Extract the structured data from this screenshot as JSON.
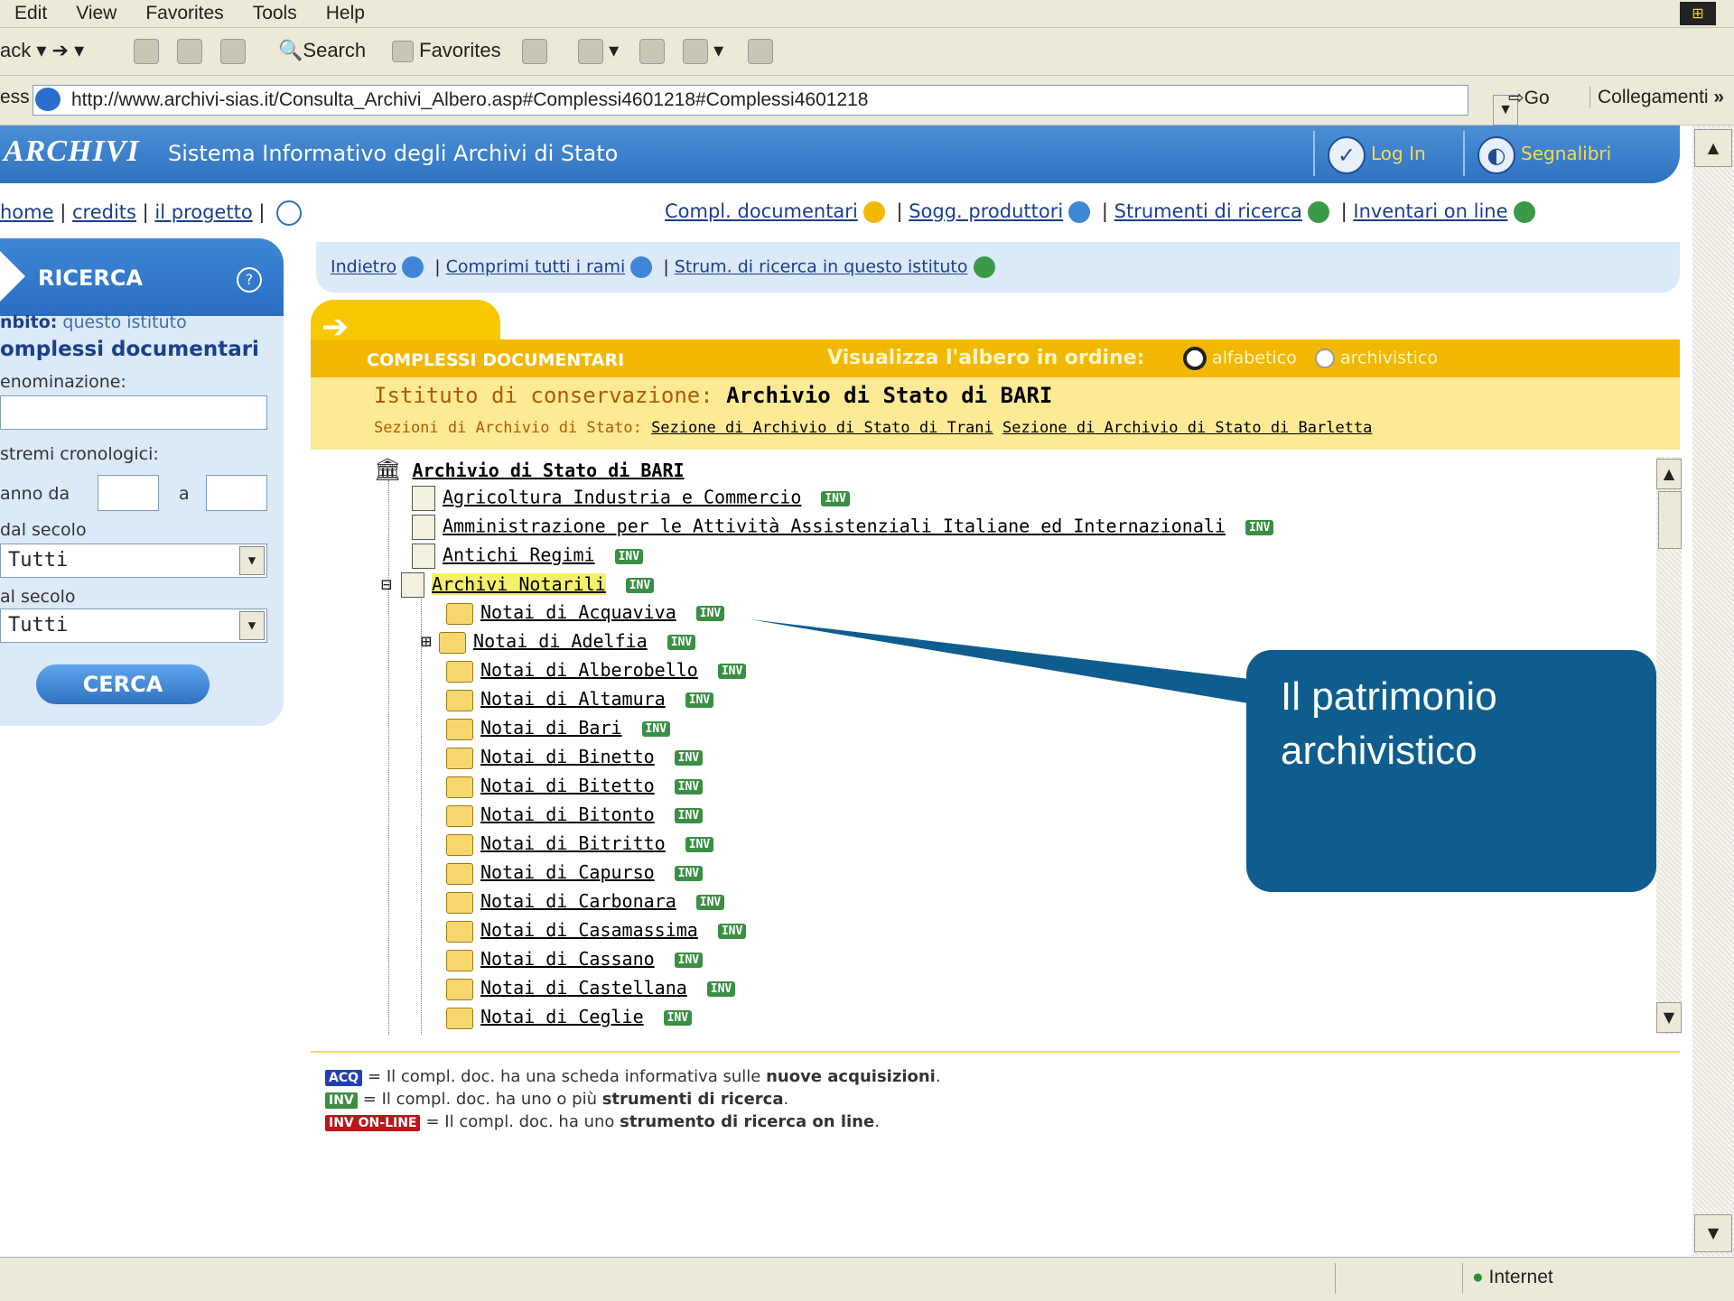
{
  "menu": [
    "Edit",
    "View",
    "Favorites",
    "Tools",
    "Help"
  ],
  "toolbar": {
    "back": "ack",
    "search": "Search",
    "favorites": "Favorites"
  },
  "address": {
    "label": "ess",
    "url": "http://www.archivi-sias.it/Consulta_Archivi_Albero.asp#Complessi4601218#Complessi4601218",
    "go": "Go",
    "links": "Collegamenti",
    "chevrons": "»"
  },
  "header": {
    "logo": "ARCHIVI",
    "subtitle": "Sistema Informativo degli Archivi di Stato",
    "login": "Log In",
    "bookmarks": "Segnalibri"
  },
  "topnav": {
    "home": "home",
    "credits": "credits",
    "progetto": "il progetto",
    "compl": "Compl. documentari",
    "sogg": "Sogg. produttori",
    "strumenti": "Strumenti di ricerca",
    "inventari": "Inventari on line"
  },
  "search": {
    "title": "RICERCA",
    "ambito_label": "nbito:",
    "ambito_value": "questo istituto",
    "section": "omplessi documentari",
    "denominazione": "enominazione:",
    "estremi": "stremi cronologici:",
    "anno_da": "anno da",
    "a": "a",
    "dal_secolo": "dal secolo",
    "al_secolo": "al secolo",
    "select1": "Tutti",
    "select2": "Tutti",
    "button": "CERCA"
  },
  "subnav": {
    "indietro": "Indietro",
    "comprimi": "Comprimi tutti i rami",
    "strum": "Strum. di ricerca in questo istituto"
  },
  "complessi": {
    "tab": "COMPLESSI DOCUMENTARI",
    "visualizza": "Visualizza l'albero in ordine:",
    "opt1": "alfabetico",
    "opt2": "archivistico",
    "istituto_label": "Istituto di conservazione:",
    "istituto_value": "Archivio di Stato di BARI",
    "sezioni_label": "Sezioni di Archivio di Stato:",
    "sezione1": "Sezione di Archivio di Stato di Trani",
    "sezione2": "Sezione di Archivio di Stato di Barletta"
  },
  "tree": {
    "root": "Archivio di Stato di BARI",
    "top": [
      "Agricoltura Industria e Commercio",
      "Amministrazione per le Attività Assistenziali Italiane ed Internazionali",
      "Antichi Regimi",
      "Archivi Notarili"
    ],
    "children": [
      "Notai di Acquaviva",
      "Notai di Adelfia",
      "Notai di Alberobello",
      "Notai di Altamura",
      "Notai di Bari",
      "Notai di Binetto",
      "Notai di Bitetto",
      "Notai di Bitonto",
      "Notai di Bitritto",
      "Notai di Capurso",
      "Notai di Carbonara",
      "Notai di Casamassima",
      "Notai di Cassano",
      "Notai di Castellana",
      "Notai di Ceglie"
    ],
    "inv": "INV"
  },
  "legend": {
    "acq_badge": "ACQ",
    "acq_text": "= Il compl. doc. ha una scheda informativa sulle",
    "acq_bold": "nuove acquisizioni",
    "inv_badge": "INV",
    "inv_text": "= Il compl. doc. ha uno o più",
    "inv_bold": "strumenti di ricerca",
    "online_badge": "INV ON-LINE",
    "online_text": "= Il compl. doc. ha uno",
    "online_bold": "strumento di ricerca on line"
  },
  "callout": {
    "text": "Il patrimonio archivistico"
  },
  "status": {
    "zone": "Internet"
  },
  "colors": {
    "brand_blue": "#2f72c1",
    "yellow": "#f2b800",
    "callout": "#0e5d8e",
    "inv_green": "#3a8f44"
  }
}
